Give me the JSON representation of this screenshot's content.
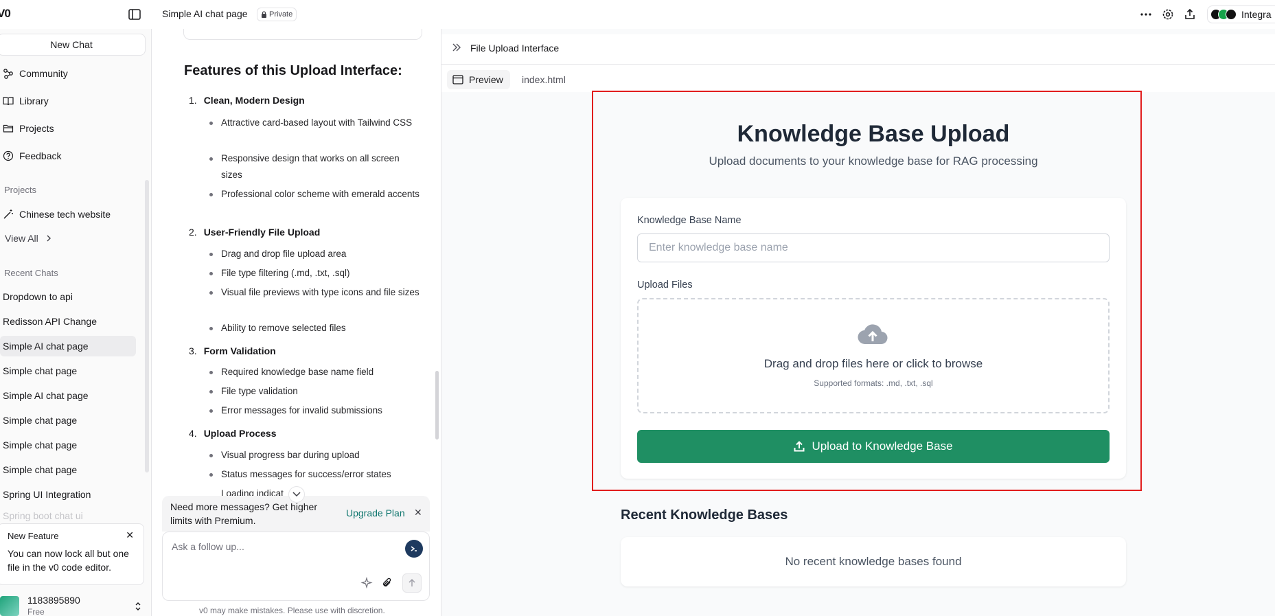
{
  "app": {
    "logo": "V0"
  },
  "header": {
    "chat_title": "Simple AI chat page",
    "private_badge": "Private",
    "integration_label": "Integra"
  },
  "sidebar": {
    "new_chat": "New Chat",
    "nav": [
      {
        "label": "Community",
        "icon": "community-icon"
      },
      {
        "label": "Library",
        "icon": "book-icon"
      },
      {
        "label": "Projects",
        "icon": "folder-icon"
      },
      {
        "label": "Feedback",
        "icon": "help-icon"
      }
    ],
    "projects_label": "Projects",
    "project_item": "Chinese tech website",
    "view_all": "View All",
    "recent_label": "Recent Chats",
    "recent_chats": [
      "Dropdown to api",
      "Redisson API Change",
      "Simple AI chat page",
      "Simple chat page",
      "Simple AI chat page",
      "Simple chat page",
      "Simple chat page",
      "Simple chat page",
      "Spring UI Integration",
      "Spring boot chat ui"
    ],
    "new_feature": {
      "title": "New Feature",
      "body": "You can now lock all but one file in the v0 code editor."
    },
    "user": {
      "name": "1183895890",
      "plan": "Free"
    }
  },
  "chat": {
    "heading": "Features of this Upload Interface:",
    "sections": [
      {
        "num": "1.",
        "title": "Clean, Modern Design",
        "bullets": [
          "Attractive card-based layout with Tailwind CSS",
          "Responsive design that works on all screen sizes",
          "Professional color scheme with emerald accents"
        ]
      },
      {
        "num": "2.",
        "title": "User-Friendly File Upload",
        "bullets": [
          "Drag and drop file upload area",
          "File type filtering (.md, .txt, .sql)",
          "Visual file previews with type icons and file sizes",
          "Ability to remove selected files"
        ]
      },
      {
        "num": "3.",
        "title": "Form Validation",
        "bullets": [
          "Required knowledge base name field",
          "File type validation",
          "Error messages for invalid submissions"
        ]
      },
      {
        "num": "4.",
        "title": "Upload Process",
        "bullets": [
          "Visual progress bar during upload",
          "Status messages for success/error states",
          "Loading indicat"
        ]
      }
    ],
    "upgrade_text": "Need more messages? Get higher limits with Premium.",
    "upgrade_link": "Upgrade Plan",
    "input_placeholder": "Ask a follow up...",
    "disclaimer": "v0 may make mistakes. Please use with discretion."
  },
  "preview": {
    "panel_title": "File Upload Interface",
    "tab_preview": "Preview",
    "tab_code": "index.html",
    "page": {
      "title": "Knowledge Base Upload",
      "subtitle": "Upload documents to your knowledge base for RAG processing",
      "name_label": "Knowledge Base Name",
      "name_placeholder": "Enter knowledge base name",
      "files_label": "Upload Files",
      "drop_text": "Drag and drop files here or click to browse",
      "drop_formats": "Supported formats: .md, .txt, .sql",
      "upload_button": "Upload to Knowledge Base",
      "recent_heading": "Recent Knowledge Bases",
      "recent_empty": "No recent knowledge bases found"
    }
  },
  "colors": {
    "accent": "#1f8f63",
    "highlight_border": "#e11d1d"
  }
}
